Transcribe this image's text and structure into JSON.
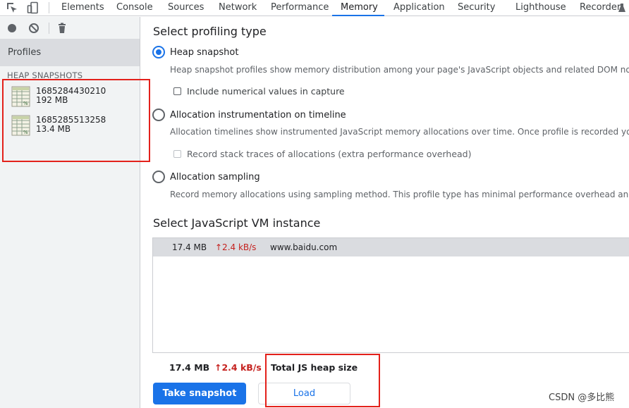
{
  "tabs": [
    "Elements",
    "Console",
    "Sources",
    "Network",
    "Performance",
    "Memory",
    "Application",
    "Security",
    "Lighthouse",
    "Recorder"
  ],
  "active_tab": "Memory",
  "toolbar_icons": [
    "inspect-element-icon",
    "device-toolbar-icon"
  ],
  "sidebar": {
    "toolbar_icons": [
      "record-icon",
      "clear-icon",
      "delete-icon"
    ],
    "profiles_label": "Profiles",
    "section_label": "HEAP SNAPSHOTS",
    "snapshots": [
      {
        "name": "1685284430210",
        "size": "192 MB"
      },
      {
        "name": "1685285513258",
        "size": "13.4 MB"
      }
    ]
  },
  "main": {
    "profiling_title": "Select profiling type",
    "options": [
      {
        "label": "Heap snapshot",
        "selected": true,
        "description": "Heap snapshot profiles show memory distribution among your page's JavaScript objects and related DOM nodes.",
        "checkbox": {
          "label": "Include numerical values in capture",
          "checked": false,
          "disabled": false
        }
      },
      {
        "label": "Allocation instrumentation on timeline",
        "selected": false,
        "description": "Allocation timelines show instrumented JavaScript memory allocations over time. Once profile is recorded you can select a time interval.",
        "checkbox": {
          "label": "Record stack traces of allocations (extra performance overhead)",
          "checked": false,
          "disabled": true
        }
      },
      {
        "label": "Allocation sampling",
        "selected": false,
        "description": "Record memory allocations using sampling method. This profile type has minimal performance overhead and can be used for long running operations."
      }
    ],
    "vm_title": "Select JavaScript VM instance",
    "vm_instances": [
      {
        "size": "17.4 MB",
        "rate": "↑2.4 kB/s",
        "url": "www.baidu.com"
      }
    ],
    "footer": {
      "size": "17.4 MB",
      "rate": "↑2.4 kB/s",
      "label": "Total JS heap size"
    },
    "take_snapshot_label": "Take snapshot",
    "load_label": "Load"
  },
  "colors": {
    "accent": "#1a73e8",
    "annotation": "#e3211b",
    "rate": "#c5221f"
  },
  "watermark": "CSDN @多比熊"
}
